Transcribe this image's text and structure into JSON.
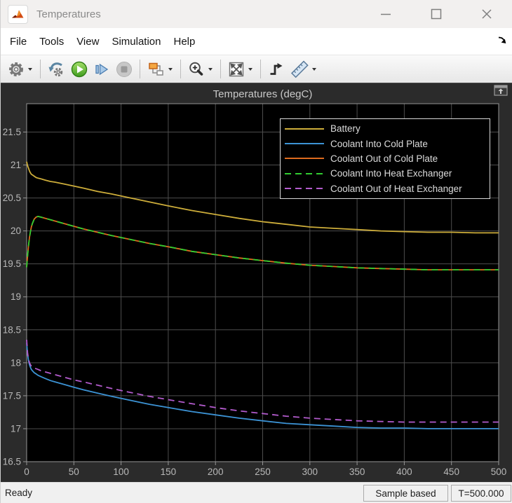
{
  "window": {
    "title": "Temperatures"
  },
  "menu": {
    "items": [
      "File",
      "Tools",
      "View",
      "Simulation",
      "Help"
    ]
  },
  "toolbar": {
    "buttons": [
      "settings",
      "highlight-block",
      "run",
      "step-forward",
      "stop",
      "signal-selector",
      "zoom-in",
      "fit-to-view",
      "trigger",
      "measurements"
    ]
  },
  "statusbar": {
    "ready": "Ready",
    "sample_mode": "Sample based",
    "sim_time": "T=500.000"
  },
  "colors": {
    "scope_bg": "#2b2b2b",
    "plot_bg": "#000000",
    "grid": "#4d4d4d",
    "frame": "#969696",
    "tick_label": "#b8b8b8",
    "legend_text": "#dcdcdc",
    "battery": "#CDAD3A",
    "coolant_in_cold": "#3C93D5",
    "coolant_out_cold": "#DD6B1E",
    "coolant_in_hx": "#31CC31",
    "coolant_out_hx": "#B35BCD"
  },
  "chart_data": {
    "type": "line",
    "title": "Temperatures (degC)",
    "xlabel": "",
    "ylabel": "",
    "xlim": [
      0,
      500
    ],
    "ylim": [
      16.5,
      21.93
    ],
    "xticks": [
      0,
      50,
      100,
      150,
      200,
      250,
      300,
      350,
      400,
      450,
      500
    ],
    "yticks": [
      16.5,
      17,
      17.5,
      18,
      18.5,
      19,
      19.5,
      20,
      20.5,
      21,
      21.5
    ],
    "grid": true,
    "legend_position": "top-right",
    "x": [
      0,
      1,
      2,
      3,
      4,
      5,
      6,
      8,
      10,
      12,
      15,
      20,
      25,
      30,
      40,
      50,
      60,
      75,
      90,
      110,
      130,
      150,
      175,
      200,
      225,
      250,
      275,
      300,
      325,
      350,
      375,
      400,
      425,
      450,
      475,
      500
    ],
    "series": [
      {
        "name": "Battery",
        "color": "#CDAD3A",
        "dash": "solid",
        "values": [
          21.05,
          20.99,
          20.95,
          20.91,
          20.88,
          20.86,
          20.85,
          20.83,
          20.81,
          20.8,
          20.79,
          20.77,
          20.75,
          20.74,
          20.71,
          20.68,
          20.65,
          20.6,
          20.56,
          20.5,
          20.44,
          20.38,
          20.31,
          20.25,
          20.19,
          20.14,
          20.1,
          20.06,
          20.04,
          20.02,
          20.0,
          19.99,
          19.98,
          19.98,
          19.97,
          19.97
        ]
      },
      {
        "name": "Coolant Into Cold Plate",
        "color": "#3C93D5",
        "dash": "solid",
        "values": [
          18.3,
          18.13,
          18.03,
          17.97,
          17.93,
          17.9,
          17.88,
          17.85,
          17.83,
          17.81,
          17.79,
          17.76,
          17.73,
          17.71,
          17.67,
          17.63,
          17.59,
          17.54,
          17.49,
          17.43,
          17.37,
          17.32,
          17.26,
          17.21,
          17.16,
          17.12,
          17.08,
          17.06,
          17.04,
          17.02,
          17.01,
          17.01,
          17.0,
          17.0,
          17.0,
          17.0
        ]
      },
      {
        "name": "Coolant Out of Cold Plate",
        "color": "#DD6B1E",
        "dash": "solid",
        "values": [
          19.45,
          19.62,
          19.78,
          19.9,
          19.99,
          20.06,
          20.11,
          20.18,
          20.21,
          20.22,
          20.21,
          20.19,
          20.17,
          20.15,
          20.11,
          20.07,
          20.03,
          19.98,
          19.93,
          19.87,
          19.81,
          19.76,
          19.69,
          19.64,
          19.59,
          19.55,
          19.51,
          19.48,
          19.46,
          19.44,
          19.43,
          19.42,
          19.41,
          19.41,
          19.41,
          19.41
        ]
      },
      {
        "name": "Coolant Into Heat Exchanger",
        "color": "#31CC31",
        "dash": "dashed",
        "values": [
          19.45,
          19.62,
          19.78,
          19.9,
          19.99,
          20.06,
          20.11,
          20.18,
          20.21,
          20.22,
          20.21,
          20.19,
          20.17,
          20.15,
          20.11,
          20.07,
          20.03,
          19.98,
          19.93,
          19.87,
          19.81,
          19.76,
          19.69,
          19.64,
          19.59,
          19.55,
          19.51,
          19.48,
          19.46,
          19.44,
          19.43,
          19.42,
          19.41,
          19.41,
          19.41,
          19.41
        ]
      },
      {
        "name": "Coolant Out of Heat Exchanger",
        "color": "#B35BCD",
        "dash": "dashed",
        "values": [
          18.35,
          18.15,
          18.05,
          18.0,
          17.97,
          17.95,
          17.94,
          17.92,
          17.91,
          17.9,
          17.88,
          17.86,
          17.84,
          17.82,
          17.78,
          17.74,
          17.71,
          17.66,
          17.61,
          17.55,
          17.49,
          17.44,
          17.38,
          17.32,
          17.27,
          17.23,
          17.19,
          17.16,
          17.14,
          17.12,
          17.11,
          17.1,
          17.1,
          17.1,
          17.1,
          17.1
        ]
      }
    ]
  }
}
